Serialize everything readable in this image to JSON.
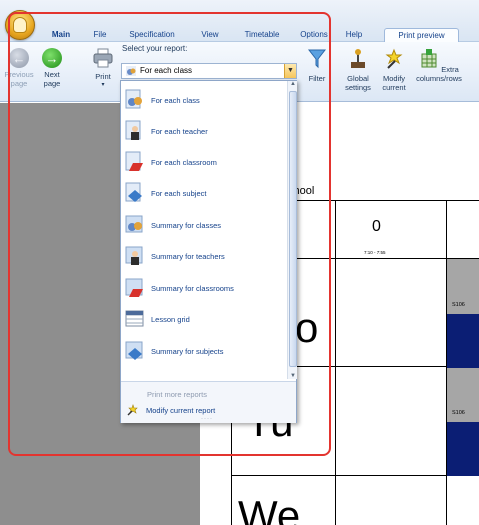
{
  "tabs": [
    {
      "label": "Main"
    },
    {
      "label": "File"
    },
    {
      "label": "Specification"
    },
    {
      "label": "View"
    },
    {
      "label": "Timetable"
    },
    {
      "label": "Options"
    },
    {
      "label": "Help"
    },
    {
      "label": "Print preview"
    }
  ],
  "ribbon": {
    "previous_page": "Previous page",
    "next_page": "Next page",
    "print": "Print",
    "select_report_label": "Select your report:",
    "selected_report": "For each class",
    "filter": "Filter",
    "global_settings": "Global settings",
    "modify_current": "Modify current",
    "extra_columns_rows": "Extra columns/rows"
  },
  "dropdown": {
    "items": [
      {
        "label": "For each class",
        "icon": "class-report-icon"
      },
      {
        "label": "For each teacher",
        "icon": "teacher-report-icon"
      },
      {
        "label": "For each classroom",
        "icon": "classroom-report-icon"
      },
      {
        "label": "For each subject",
        "icon": "subject-report-icon"
      },
      {
        "label": "Summary for classes",
        "icon": "class-summary-icon"
      },
      {
        "label": "Summary for teachers",
        "icon": "teacher-summary-icon"
      },
      {
        "label": "Summary for classrooms",
        "icon": "classroom-summary-icon"
      },
      {
        "label": "Lesson grid",
        "icon": "lesson-grid-icon"
      },
      {
        "label": "Summary for subjects",
        "icon": "subject-summary-icon"
      }
    ],
    "print_more": "Print more reports",
    "modify_current": "Modify current report"
  },
  "preview": {
    "school_text": "chool",
    "period_number": "0",
    "period_time": "7:10 - 7:55",
    "day_mo": "o",
    "day_tu": "Tu",
    "day_we": "We",
    "room_1": "S106",
    "room_2": "S106"
  },
  "colors": {
    "highlight": "#e3342f",
    "navy_cell": "#0b1e74",
    "ribbon_text": "#15428b"
  }
}
